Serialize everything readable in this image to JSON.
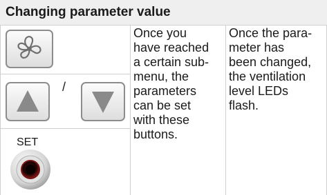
{
  "header": {
    "title": "Changing parameter value"
  },
  "button_column": {
    "fan_button_icon": "fan-icon",
    "up_button_icon": "up-triangle-icon",
    "separator": "/",
    "down_button_icon": "down-triangle-icon",
    "set_label": "SET"
  },
  "description_column": {
    "lines": [
      "Once you",
      "have reached",
      "a certain sub-",
      "menu, the",
      "parameters",
      "can be set",
      "with these",
      "buttons."
    ]
  },
  "result_column": {
    "lines": [
      "Once the para-",
      "meter has",
      "been changed,",
      "the ventilation",
      "level LEDs",
      "flash."
    ]
  },
  "colors": {
    "header_bg": "#efefef",
    "border": "#cfcfcf",
    "button_gray": "#8c8c8c",
    "set_red": "#8b1a1a"
  }
}
